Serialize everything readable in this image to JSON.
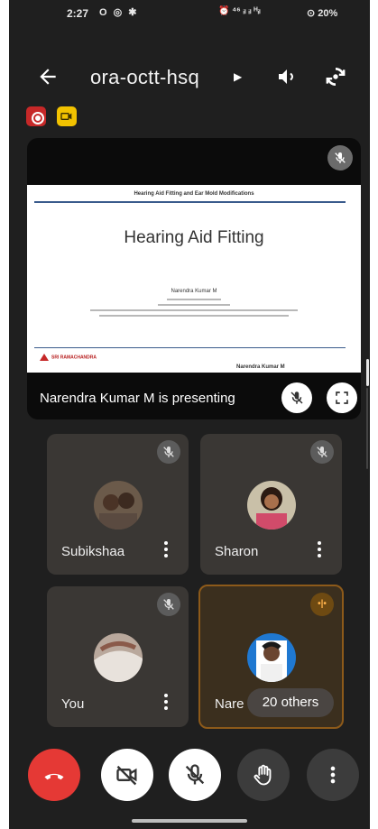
{
  "status_bar": {
    "time": "2:27",
    "left_icons": "O ◎ ✱",
    "right_icons": "⏰ ⁴⁶ ᵢₗ ᵢₗ ᴴᵢₗ",
    "battery": "⊙ 20%"
  },
  "header": {
    "meeting_code": "ora-octt-hsq"
  },
  "presentation": {
    "slide_header": "Hearing Aid Fitting and Ear Mold Modifications",
    "slide_title": "Hearing Aid Fitting",
    "slide_author": "Narendra Kumar M",
    "slide_logo_text": "SRI RAMACHANDRA",
    "slide_footer_name": "Narendra Kumar M",
    "presenting_label": "Narendra Kumar M is presenting"
  },
  "participants": [
    {
      "name": "Subikshaa",
      "muted": true
    },
    {
      "name": "Sharon",
      "muted": true
    },
    {
      "name": "You",
      "muted": true
    },
    {
      "name": "Nare",
      "speaking": true
    }
  ],
  "others_chip": "20 others",
  "colors": {
    "background": "#1f1f1f",
    "tile": "#3a3734",
    "active_tile_border": "#8d5a1a",
    "end_call": "#e53935",
    "record_badge": "#c62828",
    "camera_badge": "#f2c200"
  },
  "icons": {
    "back": "arrow-left-icon",
    "speaker": "speaker-icon",
    "switch_camera": "switch-camera-icon",
    "mic_off": "mic-off-icon",
    "fullscreen": "fullscreen-icon",
    "end_call": "phone-hangup-icon",
    "camera_off": "camera-off-icon",
    "raise_hand": "hand-icon",
    "more": "more-vert-icon"
  }
}
